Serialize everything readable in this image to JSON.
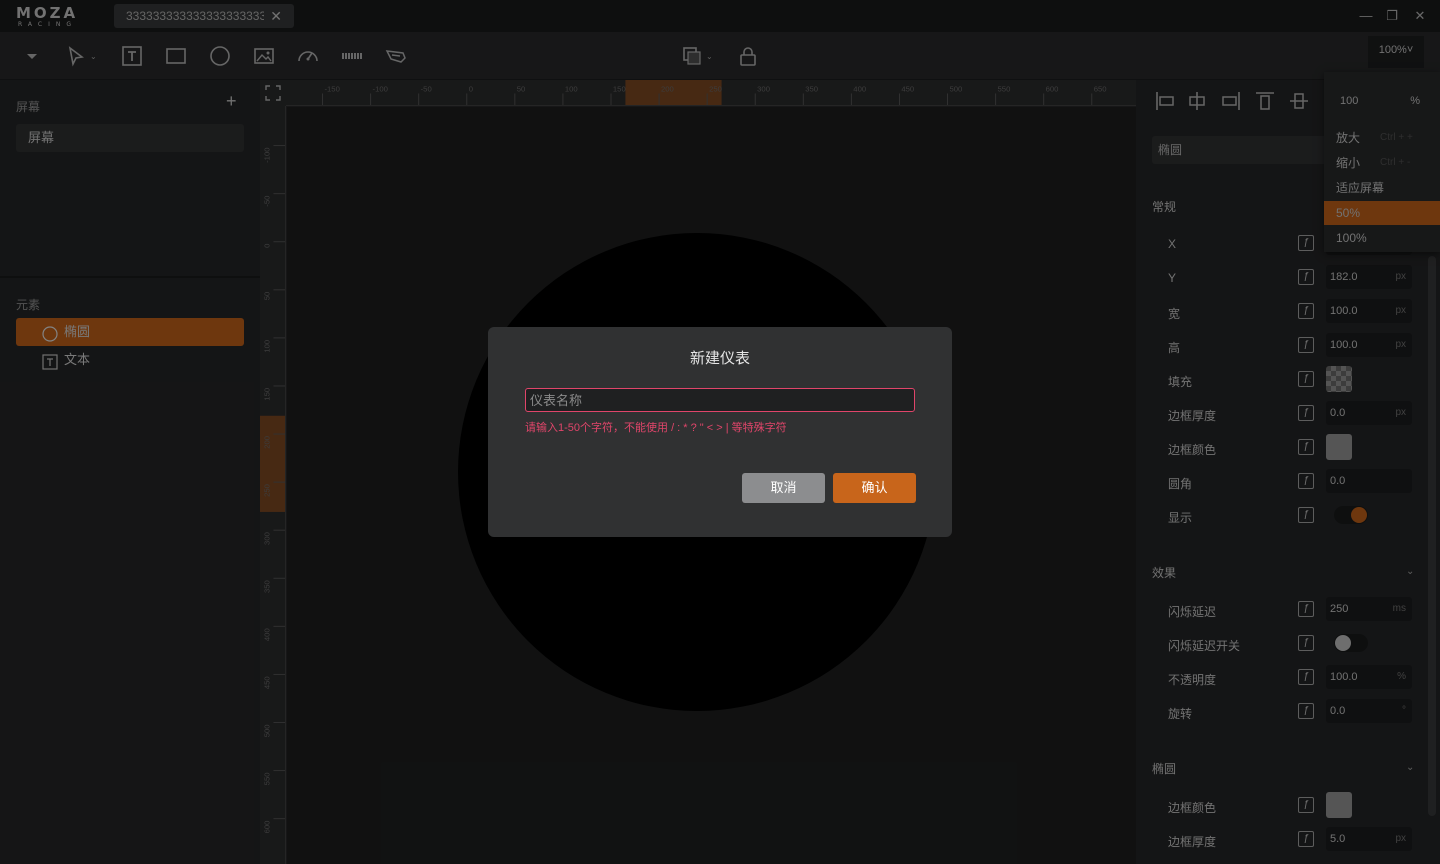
{
  "app": {
    "logo_main": "MOZA",
    "logo_sub": "RACING"
  },
  "tabs": [
    {
      "label": "3333333333333333333333333"
    }
  ],
  "toolbar": {
    "zoom": "100%",
    "zoom_chevron": "˅"
  },
  "left": {
    "screens_title": "屏幕",
    "add_label": "+",
    "screens": [
      {
        "label": "屏幕"
      }
    ],
    "elements_title": "元素",
    "elements": [
      {
        "label": "椭圆",
        "selected": true
      },
      {
        "label": "文本",
        "selected": false
      }
    ]
  },
  "rulers": {
    "h_ticks": [
      "-150",
      "-100",
      "-50",
      "0",
      "50",
      "100",
      "150",
      "200",
      "250",
      "300",
      "350",
      "400",
      "450",
      "500",
      "550",
      "600",
      "650"
    ],
    "v_ticks": [
      "-100",
      "-50",
      "0",
      "50",
      "100",
      "150",
      "200",
      "250",
      "300",
      "350",
      "400",
      "450",
      "500",
      "550",
      "600"
    ]
  },
  "right": {
    "name": "椭圆",
    "general_title": "常规",
    "props": [
      {
        "label": "X",
        "value": "",
        "unit": ""
      },
      {
        "label": "Y",
        "value": "182.0",
        "unit": "px"
      },
      {
        "label": "宽",
        "value": "100.0",
        "unit": "px"
      },
      {
        "label": "高",
        "value": "100.0",
        "unit": "px"
      },
      {
        "label": "填充",
        "value": "",
        "unit": ""
      },
      {
        "label": "边框厚度",
        "value": "0.0",
        "unit": "px"
      },
      {
        "label": "边框颜色",
        "value": "",
        "unit": ""
      },
      {
        "label": "圆角",
        "value": "0.0",
        "unit": ""
      },
      {
        "label": "显示",
        "value": "",
        "unit": ""
      }
    ],
    "effects_title": "效果",
    "effects": [
      {
        "label": "闪烁延迟",
        "value": "250",
        "unit": "ms"
      },
      {
        "label": "闪烁延迟开关",
        "value": "",
        "unit": ""
      },
      {
        "label": "不透明度",
        "value": "100.0",
        "unit": "%"
      },
      {
        "label": "旋转",
        "value": "0.0",
        "unit": "°"
      }
    ],
    "ellipse_title": "椭圆",
    "ellipse": [
      {
        "label": "边框颜色",
        "value": "",
        "unit": ""
      },
      {
        "label": "边框厚度",
        "value": "5.0",
        "unit": "px"
      }
    ]
  },
  "zoom_dropdown": {
    "input_value": "100",
    "input_unit": "%",
    "options": [
      {
        "label": "放大",
        "shortcut": "Ctrl + +",
        "selected": false
      },
      {
        "label": "缩小",
        "shortcut": "Ctrl + -",
        "selected": false
      },
      {
        "label": "适应屏幕",
        "shortcut": "",
        "selected": false
      },
      {
        "label": "50%",
        "shortcut": "",
        "selected": true
      },
      {
        "label": "100%",
        "shortcut": "",
        "selected": false
      }
    ]
  },
  "modal": {
    "title": "新建仪表",
    "input_value": "",
    "input_placeholder": "仪表名称",
    "error": "请输入1-50个字符，不能使用 / : * ? \" < > | 等特殊字符",
    "cancel": "取消",
    "confirm": "确认"
  },
  "colors": {
    "accent": "#c8651b",
    "error": "#e0456a",
    "canvas": "#1f2020",
    "panel": "#262728"
  }
}
